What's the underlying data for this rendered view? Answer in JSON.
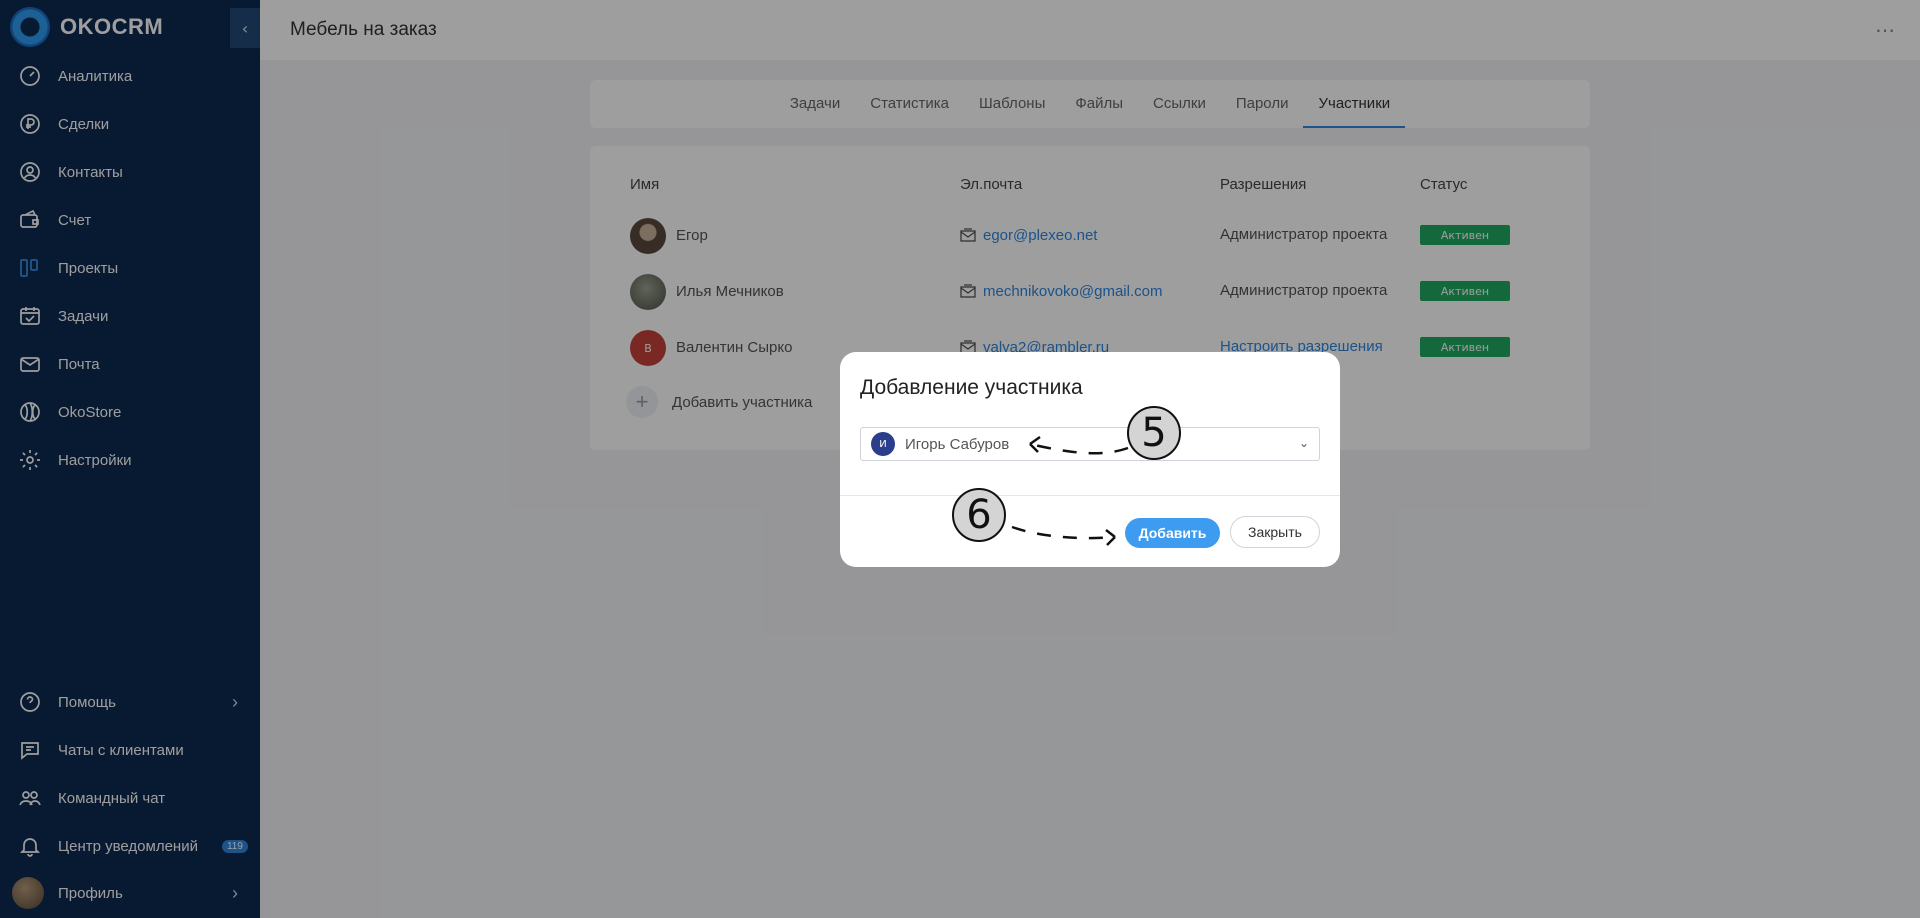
{
  "app": {
    "brand": "OKOCRM"
  },
  "sidebar": {
    "items": [
      {
        "label": "Аналитика",
        "icon": "analytics-icon"
      },
      {
        "label": "Сделки",
        "icon": "ruble-icon"
      },
      {
        "label": "Контакты",
        "icon": "contact-icon"
      },
      {
        "label": "Счет",
        "icon": "wallet-icon"
      },
      {
        "label": "Проекты",
        "icon": "projects-icon"
      },
      {
        "label": "Задачи",
        "icon": "calendar-check-icon"
      },
      {
        "label": "Почта",
        "icon": "mail-icon"
      },
      {
        "label": "OkoStore",
        "icon": "store-icon"
      },
      {
        "label": "Настройки",
        "icon": "gear-icon"
      }
    ],
    "bottom_items": [
      {
        "label": "Помощь",
        "icon": "help-icon"
      },
      {
        "label": "Чаты с клиентами",
        "icon": "chat-icon"
      },
      {
        "label": "Командный чат",
        "icon": "team-icon"
      },
      {
        "label": "Центр уведомлений",
        "icon": "bell-icon",
        "badge": "119"
      },
      {
        "label": "Профиль",
        "icon": "avatar"
      }
    ]
  },
  "header": {
    "title": "Мебель на заказ"
  },
  "tabs": [
    {
      "label": "Задачи"
    },
    {
      "label": "Статистика"
    },
    {
      "label": "Шаблоны"
    },
    {
      "label": "Файлы"
    },
    {
      "label": "Ссылки"
    },
    {
      "label": "Пароли"
    },
    {
      "label": "Участники",
      "active": true
    }
  ],
  "members": {
    "columns": {
      "name": "Имя",
      "email": "Эл.почта",
      "permissions": "Разрешения",
      "status": "Статус"
    },
    "rows": [
      {
        "name": "Егор",
        "email": "egor@plexeo.net",
        "permissions": "Администратор проекта",
        "status": "Активен"
      },
      {
        "name": "Илья Мечников",
        "email": "mechnikovoko@gmail.com",
        "permissions": "Администратор проекта",
        "status": "Активен"
      },
      {
        "name": "Валентин Сырко",
        "avatar_letter": "В",
        "email": "valya2@rambler.ru",
        "permissions": "Настроить разрешения",
        "status": "Активен"
      }
    ],
    "add_label": "Добавить участника"
  },
  "modal": {
    "title": "Добавление участника",
    "selected_user": "Игорь Сабуров",
    "selected_initial": "И",
    "add_button": "Добавить",
    "close_button": "Закрыть"
  },
  "callouts": {
    "step5": "5",
    "step6": "6"
  },
  "colors": {
    "sidebar_bg": "#0d2a4f",
    "accent": "#2e86de",
    "status_active": "#1faa5f",
    "primary_button": "#3d9bf0"
  }
}
